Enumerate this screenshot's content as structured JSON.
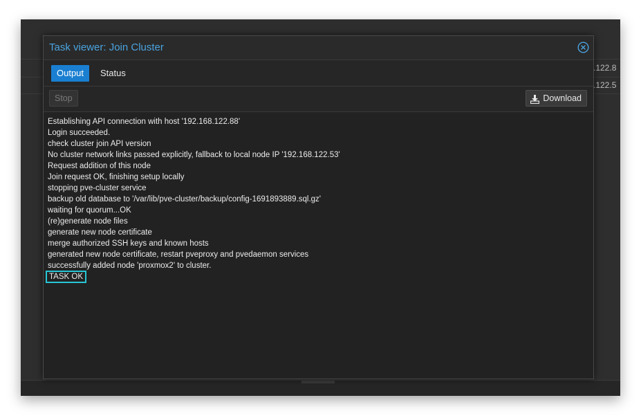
{
  "background": {
    "ip_fragments": [
      ".122.8",
      ".122.5"
    ]
  },
  "window": {
    "title": "Task viewer: Join Cluster",
    "close_icon": "circle-x-icon",
    "accent_color": "#4aa3df"
  },
  "tabs": [
    {
      "label": "Output",
      "active": true
    },
    {
      "label": "Status",
      "active": false
    }
  ],
  "toolbar": {
    "stop_label": "Stop",
    "download_label": "Download",
    "download_icon": "download-icon"
  },
  "log": {
    "lines": [
      "Establishing API connection with host '192.168.122.88'",
      "Login succeeded.",
      "check cluster join API version",
      "No cluster network links passed explicitly, fallback to local node IP '192.168.122.53'",
      "Request addition of this node",
      "Join request OK, finishing setup locally",
      "stopping pve-cluster service",
      "backup old database to '/var/lib/pve-cluster/backup/config-1691893889.sql.gz'",
      "waiting for quorum...OK",
      "(re)generate node files",
      "generate new node certificate",
      "merge authorized SSH keys and known hosts",
      "generated new node certificate, restart pveproxy and pvedaemon services",
      "successfully added node 'proxmox2' to cluster.",
      "TASK OK"
    ],
    "highlight_color": "#27c6d6"
  }
}
